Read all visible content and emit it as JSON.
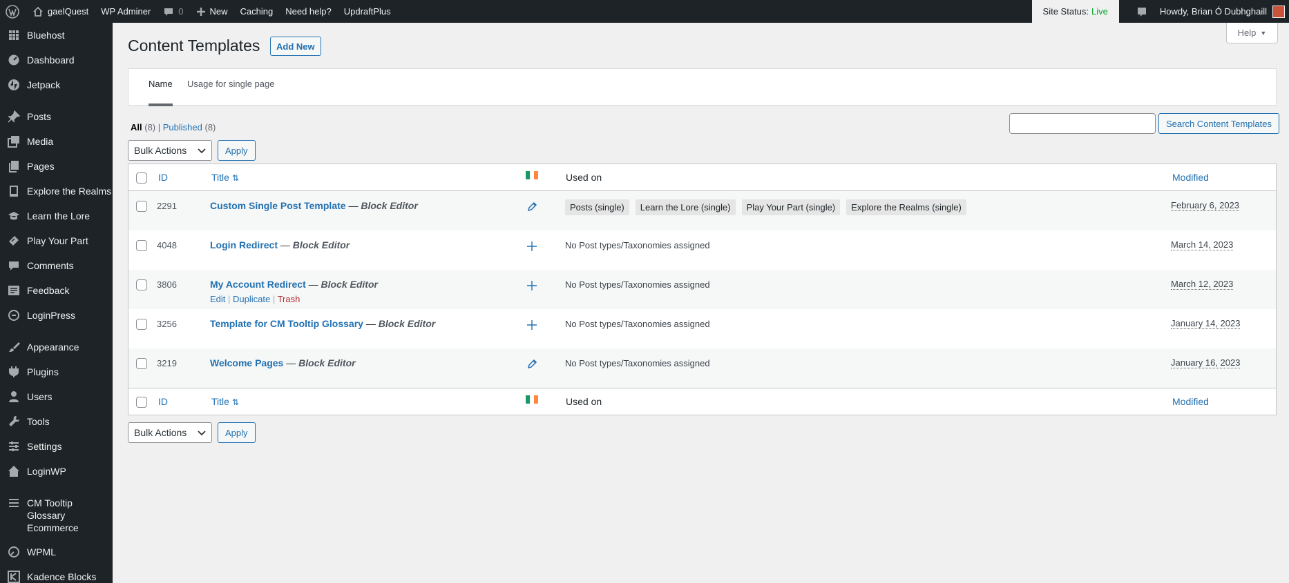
{
  "adminbar": {
    "site_name": "gaelQuest",
    "wp_adminer": "WP Adminer",
    "comments_count": "0",
    "new_label": "New",
    "caching": "Caching",
    "need_help": "Need help?",
    "updraft": "UpdraftPlus",
    "site_status_label": "Site Status:",
    "site_status_value": "Live",
    "howdy": "Howdy, Brian Ó Dubhghaill"
  },
  "sidebar": {
    "items": [
      {
        "label": "Bluehost",
        "icon": "grid-icon"
      },
      {
        "label": "Dashboard",
        "icon": "dashboard-icon"
      },
      {
        "label": "Jetpack",
        "icon": "jetpack-icon"
      },
      {
        "label": "Posts",
        "icon": "pin-icon"
      },
      {
        "label": "Media",
        "icon": "media-icon"
      },
      {
        "label": "Pages",
        "icon": "pages-icon"
      },
      {
        "label": "Explore the Realms",
        "icon": "book-icon"
      },
      {
        "label": "Learn the Lore",
        "icon": "graduation-icon"
      },
      {
        "label": "Play Your Part",
        "icon": "tickets-icon"
      },
      {
        "label": "Comments",
        "icon": "comment-icon"
      },
      {
        "label": "Feedback",
        "icon": "feedback-icon"
      },
      {
        "label": "LoginPress",
        "icon": "loginpress-icon"
      },
      {
        "label": "Appearance",
        "icon": "brush-icon"
      },
      {
        "label": "Plugins",
        "icon": "plugin-icon"
      },
      {
        "label": "Users",
        "icon": "user-icon"
      },
      {
        "label": "Tools",
        "icon": "wrench-icon"
      },
      {
        "label": "Settings",
        "icon": "settings-icon"
      },
      {
        "label": "LoginWP",
        "icon": "home-icon"
      },
      {
        "label": "CM Tooltip Glossary Ecommerce",
        "icon": "list-icon"
      },
      {
        "label": "WPML",
        "icon": "wpml-icon"
      },
      {
        "label": "Kadence Blocks",
        "icon": "kadence-icon"
      }
    ]
  },
  "page": {
    "title": "Content Templates",
    "add_new": "Add New",
    "help": "Help"
  },
  "tabs": {
    "name": "Name",
    "usage": "Usage for single page"
  },
  "filters": {
    "all": "All",
    "all_count": "(8)",
    "published": "Published",
    "published_count": "(8)"
  },
  "search": {
    "button": "Search Content Templates"
  },
  "bulk": {
    "label": "Bulk Actions",
    "apply": "Apply"
  },
  "table": {
    "columns": {
      "id": "ID",
      "title": "Title",
      "used_on": "Used on",
      "modified": "Modified"
    },
    "rows": [
      {
        "id": "2291",
        "title": "Custom Single Post Template",
        "editor": "Block Editor",
        "icon": "pencil-icon",
        "used_on": [
          "Posts (single)",
          "Learn the Lore (single)",
          "Play Your Part (single)",
          "Explore the Realms (single)"
        ],
        "modified": "February 6, 2023"
      },
      {
        "id": "4048",
        "title": "Login Redirect",
        "editor": "Block Editor",
        "icon": "plus-icon",
        "used_on_text": "No Post types/Taxonomies assigned",
        "modified": "March 14, 2023"
      },
      {
        "id": "3806",
        "title": "My Account Redirect",
        "editor": "Block Editor",
        "icon": "plus-icon",
        "used_on_text": "No Post types/Taxonomies assigned",
        "modified": "March 12, 2023",
        "actions": {
          "edit": "Edit",
          "duplicate": "Duplicate",
          "trash": "Trash"
        }
      },
      {
        "id": "3256",
        "title": "Template for CM Tooltip Glossary",
        "editor": "Block Editor",
        "icon": "plus-icon",
        "used_on_text": "No Post types/Taxonomies assigned",
        "modified": "January 14, 2023"
      },
      {
        "id": "3219",
        "title": "Welcome Pages",
        "editor": "Block Editor",
        "icon": "pencil-icon",
        "used_on_text": "No Post types/Taxonomies assigned",
        "modified": "January 16, 2023"
      }
    ],
    "separator": "—"
  },
  "colors": {
    "accent": "#2271b1",
    "adminbar_bg": "#1d2327",
    "live": "#00a32a",
    "flag": [
      "#169b62",
      "#ffffff",
      "#ff883e"
    ]
  }
}
